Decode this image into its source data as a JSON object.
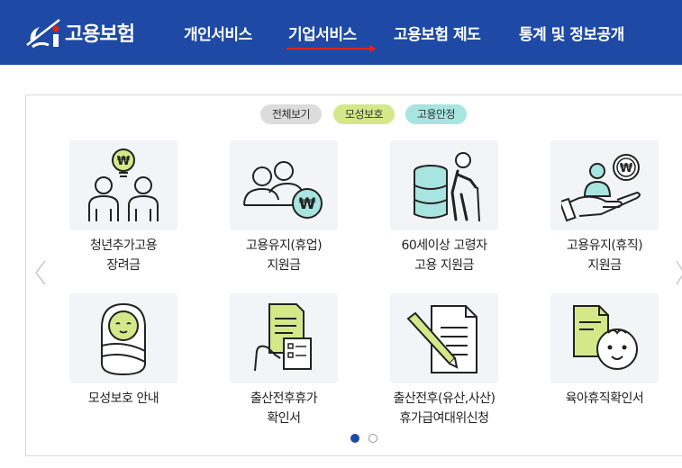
{
  "header": {
    "logo_text": "고용보험",
    "nav": [
      {
        "label": "개인서비스"
      },
      {
        "label": "기업서비스"
      },
      {
        "label": "고용보험 제도"
      },
      {
        "label": "통계 및 정보공개"
      }
    ]
  },
  "filters": [
    {
      "label": "전체보기",
      "color": "#dcdcdc"
    },
    {
      "label": "모성보호",
      "color": "#d4e88a"
    },
    {
      "label": "고용안정",
      "color": "#a8e4e0"
    }
  ],
  "cards": [
    {
      "line1": "청년추가고용",
      "line2": "장려금",
      "icon": "young-people-idea-icon"
    },
    {
      "line1": "고용유지(휴업)",
      "line2": "지원금",
      "icon": "people-won-icon"
    },
    {
      "line1": "60세이상 고령자",
      "line2": "고용 지원금",
      "icon": "elderly-database-icon"
    },
    {
      "line1": "고용유지(휴직)",
      "line2": "지원금",
      "icon": "hand-person-won-icon"
    },
    {
      "line1": "모성보호 안내",
      "line2": "",
      "icon": "swaddled-baby-icon"
    },
    {
      "line1": "출산전후휴가",
      "line2": "확인서",
      "icon": "documents-hand-icon"
    },
    {
      "line1": "출산전후(유산,사산)",
      "line2": "휴가급여대위신청",
      "icon": "document-pen-icon"
    },
    {
      "line1": "육아휴직확인서",
      "line2": "",
      "icon": "baby-document-icon"
    }
  ],
  "colors": {
    "brand": "#1e4aa6",
    "accent_green": "#d4e88a",
    "accent_mint": "#a8e4e0",
    "indicator_active": "#1e4aa6"
  },
  "pagination": {
    "pages": 2,
    "active": 1
  }
}
